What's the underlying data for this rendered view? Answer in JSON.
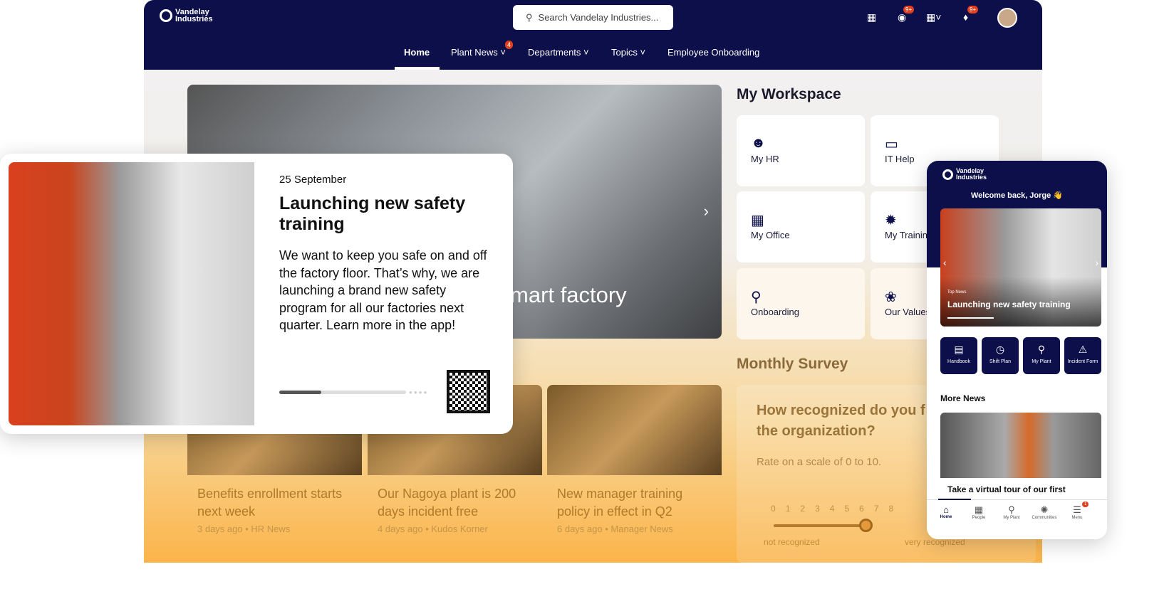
{
  "colors": {
    "navy": "#0c0f4a",
    "accent": "#fbb44a",
    "badge": "#e0401e"
  },
  "brand": {
    "line1": "Vandelay",
    "line2": "Industries"
  },
  "search": {
    "placeholder": "Search Vandelay Industries..."
  },
  "header_icons": [
    {
      "icon": "contact-card-icon"
    },
    {
      "icon": "chat-icon",
      "badge": "9+"
    },
    {
      "icon": "apps-grid-icon"
    },
    {
      "icon": "bell-icon",
      "badge": "9+"
    },
    {
      "icon": "avatar"
    }
  ],
  "nav": [
    {
      "label": "Home",
      "active": true
    },
    {
      "label": "Plant News",
      "badge": "4",
      "dropdown": true
    },
    {
      "label": "Departments",
      "dropdown": true
    },
    {
      "label": "Topics",
      "dropdown": true
    },
    {
      "label": "Employee Onboarding"
    }
  ],
  "hero": {
    "title_fragment": "mart factory"
  },
  "workspace": {
    "title": "My Workspace",
    "tiles": [
      {
        "label": "My HR",
        "icon": "people-icon"
      },
      {
        "label": "IT Help",
        "icon": "monitor-icon"
      },
      {
        "label": "My Office",
        "icon": "building-icon"
      },
      {
        "label": "My Trainin",
        "icon": "lightbulb-icon"
      },
      {
        "label": "Onboarding",
        "icon": "map-pin-icon"
      },
      {
        "label": "Our Values",
        "icon": "plant-hand-icon"
      }
    ]
  },
  "survey": {
    "title": "Monthly Survey",
    "question": "How recognized do you f the organization?",
    "hint": "Rate on a scale of 0 to 10.",
    "scale": [
      "0",
      "1",
      "2",
      "3",
      "4",
      "5",
      "6",
      "7",
      "8"
    ],
    "value": 5,
    "min_label": "not recognized",
    "max_label": "very recognized"
  },
  "news": [
    {
      "title": "Benefits enrollment starts next week",
      "meta": "3 days ago • HR News"
    },
    {
      "title": "Our Nagoya plant is 200 days incident free",
      "meta": "4 days ago • Kudos Korner"
    },
    {
      "title": "New manager training policy in effect in Q2",
      "meta": "6 days ago • Manager News"
    }
  ],
  "feature": {
    "date": "25 September",
    "title": "Launching new safety training",
    "body": "We want to keep you safe on and off the factory floor. That’s why, we are launching a brand new safety program for all our factories next quarter. Learn more in the app!",
    "progress": 0.33
  },
  "phone": {
    "welcome": "Welcome back, Jorge 👋",
    "carousel_tag": "Top News",
    "carousel_title": "Launching new safety training",
    "quick": [
      {
        "label": "Handbook",
        "icon": "handbook-icon"
      },
      {
        "label": "Shift Plan",
        "icon": "calendar-clock-icon"
      },
      {
        "label": "My Plant",
        "icon": "map-pin-icon"
      },
      {
        "label": "Incident Form",
        "icon": "warning-icon"
      }
    ],
    "more_news": "More News",
    "news_title": "Take a virtual tour of our first",
    "tabs": [
      {
        "label": "Home",
        "icon": "home-icon"
      },
      {
        "label": "People",
        "icon": "contact-card-icon"
      },
      {
        "label": "My Plant",
        "icon": "map-pin-icon"
      },
      {
        "label": "Communities",
        "icon": "network-icon"
      },
      {
        "label": "Menu",
        "icon": "menu-icon",
        "badge": "1"
      }
    ]
  }
}
